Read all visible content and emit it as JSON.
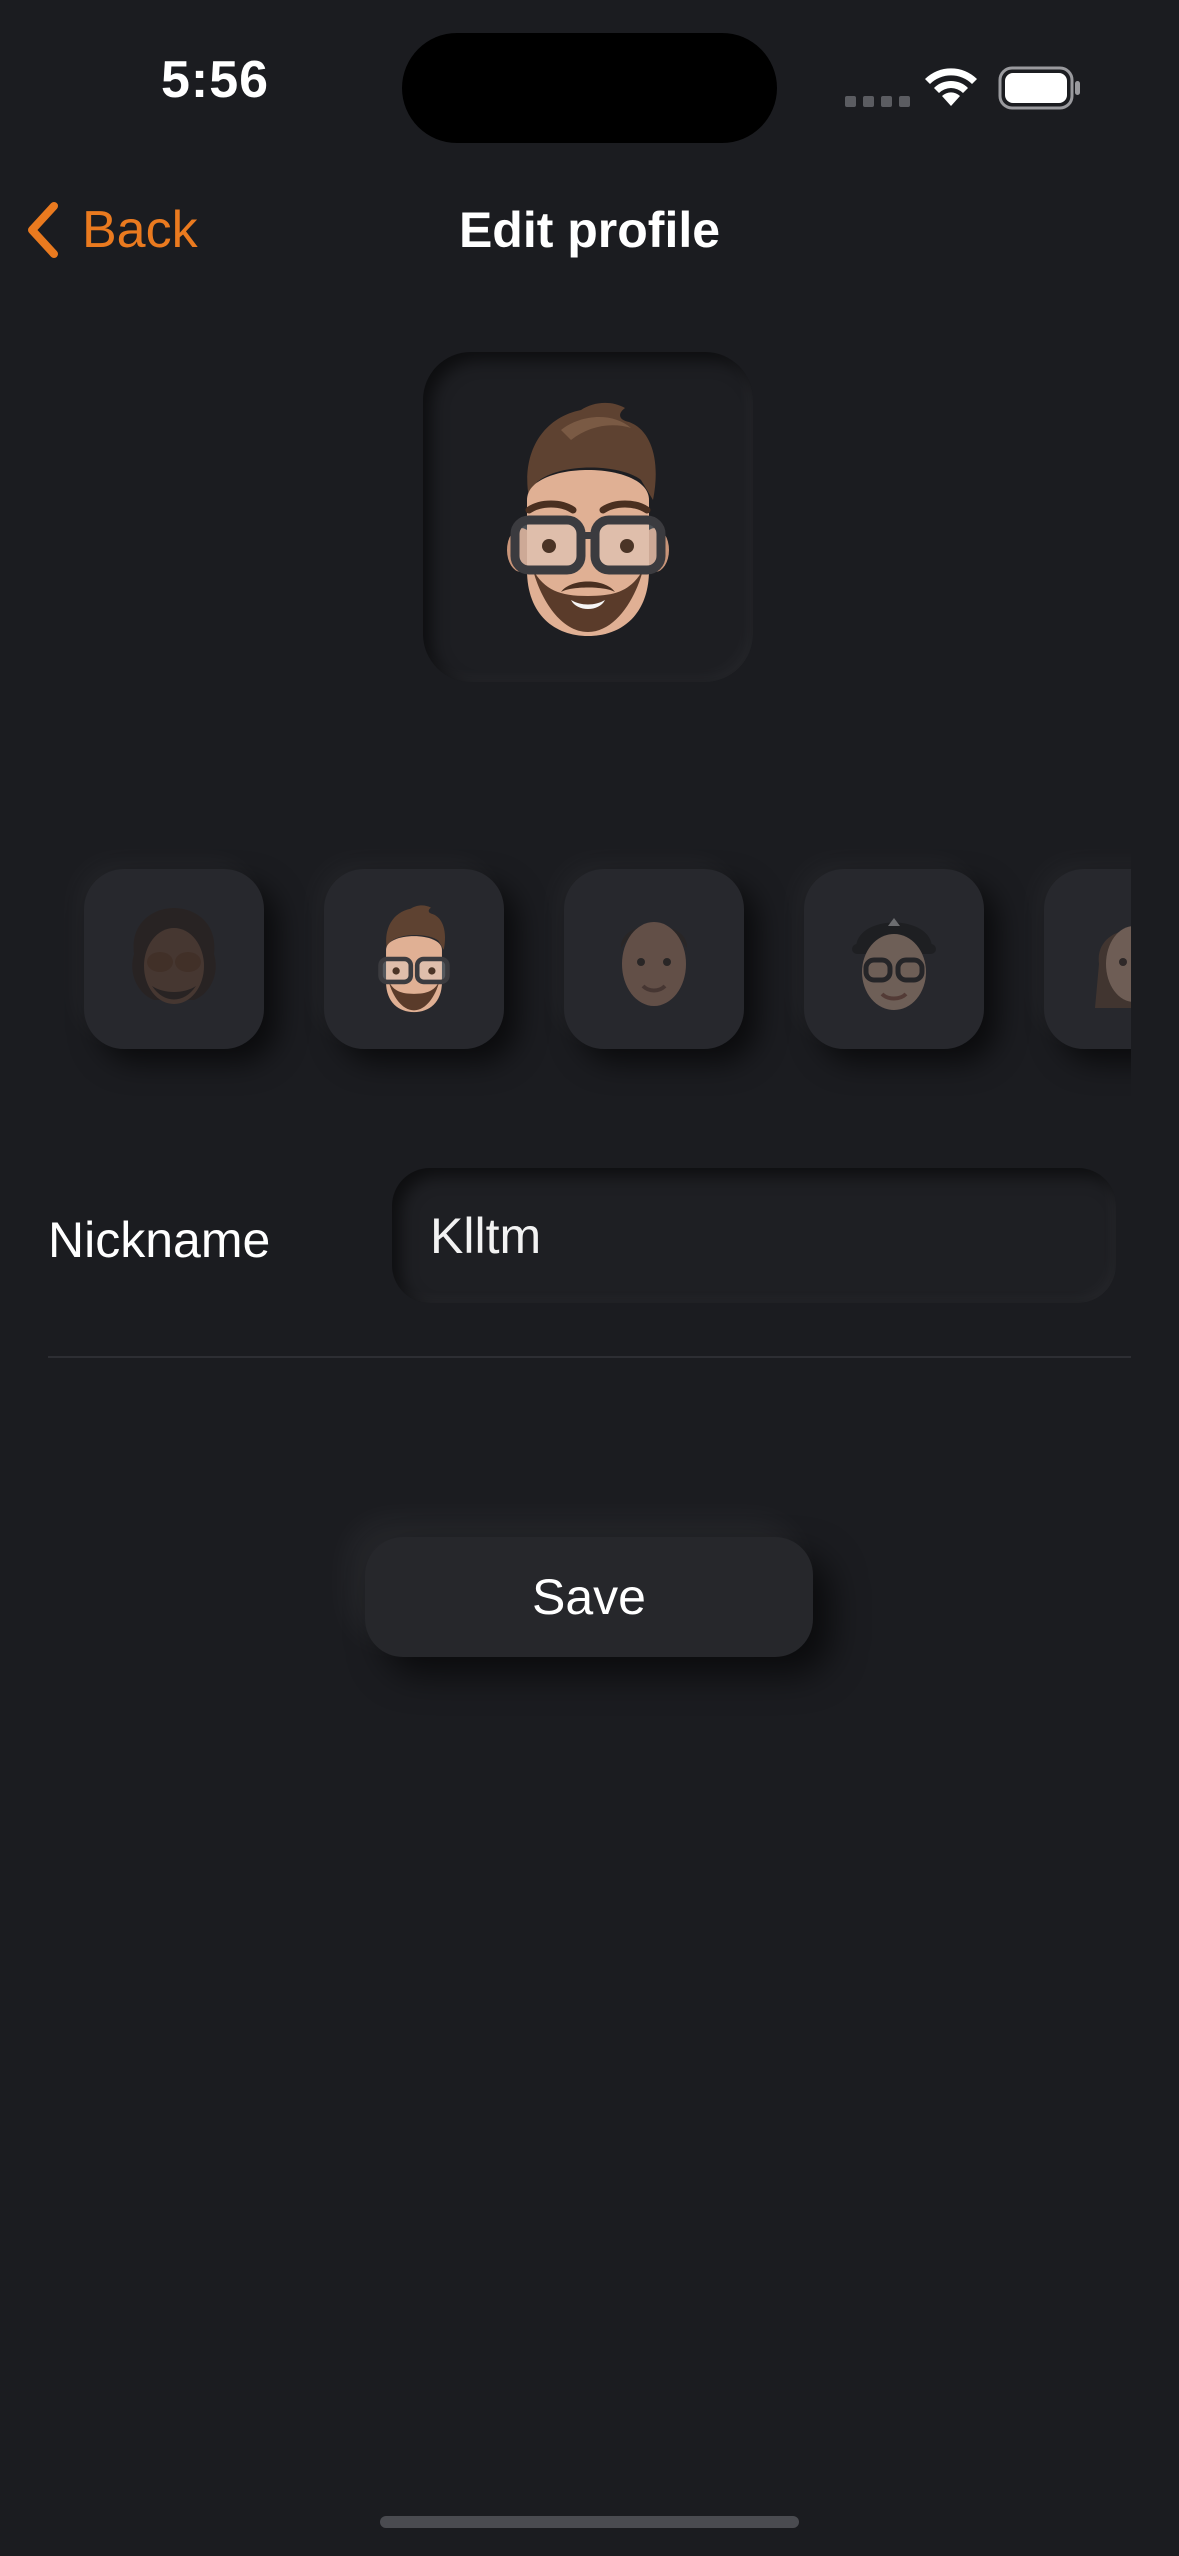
{
  "status_bar": {
    "time": "5:56",
    "icons": [
      "signal-icon",
      "wifi-icon",
      "battery-icon"
    ]
  },
  "nav": {
    "back_label": "Back",
    "title": "Edit profile",
    "accent_color": "#ea7a1f"
  },
  "profile": {
    "selected_avatar": "memoji-glasses-beard",
    "avatar_options": [
      {
        "name": "memoji-sunglasses-curly",
        "selected": false
      },
      {
        "name": "memoji-glasses-beard",
        "selected": true
      },
      {
        "name": "memoji-short-hair",
        "selected": false
      },
      {
        "name": "memoji-cap-glasses",
        "selected": false
      },
      {
        "name": "memoji-long-hair",
        "selected": false
      }
    ]
  },
  "form": {
    "nickname_label": "Nickname",
    "nickname_value": "Klltm"
  },
  "actions": {
    "save_label": "Save"
  },
  "colors": {
    "background": "#1b1c20",
    "surface": "#27282d"
  }
}
